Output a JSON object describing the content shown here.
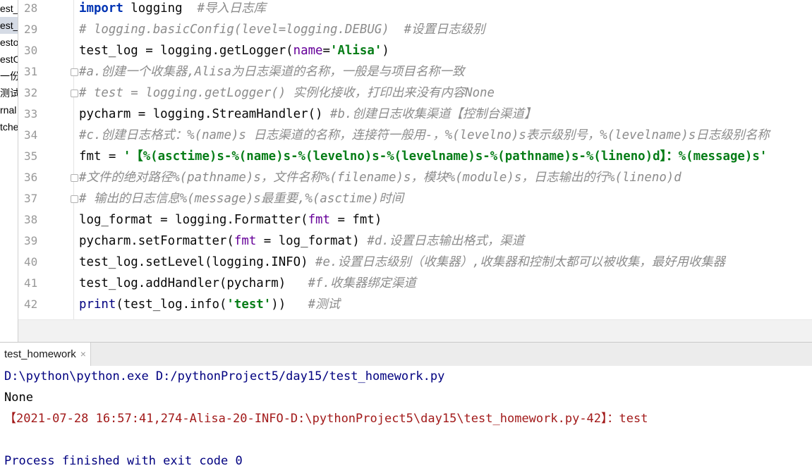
{
  "project_strip": {
    "items": [
      "est_",
      "est_",
      "esto",
      "estO",
      "一份流",
      "测试报",
      "rnal",
      "tche"
    ],
    "selected_index": 1
  },
  "editor": {
    "lines": [
      {
        "num": "28",
        "segments": [
          {
            "t": "import",
            "c": "kw"
          },
          {
            "t": " logging  ",
            "c": ""
          },
          {
            "t": "#导入日志库",
            "c": "cm"
          }
        ]
      },
      {
        "num": "29",
        "segments": [
          {
            "t": "# logging.basicConfig(level=logging.DEBUG)  #设置日志级别",
            "c": "cm"
          }
        ]
      },
      {
        "num": "30",
        "segments": [
          {
            "t": "test_log = logging.getLogger(",
            "c": ""
          },
          {
            "t": "name",
            "c": "param"
          },
          {
            "t": "=",
            "c": ""
          },
          {
            "t": "'Alisa'",
            "c": "str"
          },
          {
            "t": ")",
            "c": ""
          }
        ]
      },
      {
        "num": "31",
        "fold": true,
        "segments": [
          {
            "t": "#a.创建一个收集器,Alisa为日志渠道的名称，一般是与项目名称一致",
            "c": "cm"
          }
        ]
      },
      {
        "num": "32",
        "fold": true,
        "segments": [
          {
            "t": "# test = logging.getLogger() 实例化接收，打印出来没有内容None",
            "c": "cm"
          }
        ]
      },
      {
        "num": "33",
        "segments": [
          {
            "t": "pycharm = logging.StreamHandler() ",
            "c": ""
          },
          {
            "t": "#b.创建日志收集渠道【控制台渠道】",
            "c": "cm"
          }
        ]
      },
      {
        "num": "34",
        "segments": [
          {
            "t": "#c.创建日志格式：%(name)s 日志渠道的名称，连接符一般用-，%(levelno)s表示级别号，%(levelname)s日志级别名称",
            "c": "cm"
          }
        ]
      },
      {
        "num": "35",
        "segments": [
          {
            "t": "fmt = ",
            "c": ""
          },
          {
            "t": "'【%(asctime)s-%(name)s-%(levelno)s-%(levelname)s-%(pathname)s-%(lineno)d】：%(message)s'",
            "c": "str"
          }
        ]
      },
      {
        "num": "36",
        "fold": true,
        "segments": [
          {
            "t": "#文件的绝对路径%(pathname)s，文件名称%(filename)s，模块%(module)s，日志输出的行%(lineno)d",
            "c": "cm"
          }
        ]
      },
      {
        "num": "37",
        "fold": true,
        "segments": [
          {
            "t": "# 输出的日志信息%(message)s最重要,%(asctime)时间",
            "c": "cm"
          }
        ]
      },
      {
        "num": "38",
        "segments": [
          {
            "t": "log_format = logging.Formatter(",
            "c": ""
          },
          {
            "t": "fmt",
            "c": "param"
          },
          {
            "t": " = fmt)",
            "c": ""
          }
        ]
      },
      {
        "num": "39",
        "segments": [
          {
            "t": "pycharm.setFormatter(",
            "c": ""
          },
          {
            "t": "fmt",
            "c": "param"
          },
          {
            "t": " = log_format) ",
            "c": ""
          },
          {
            "t": "#d.设置日志输出格式，渠道",
            "c": "cm"
          }
        ]
      },
      {
        "num": "40",
        "segments": [
          {
            "t": "test_log.setLevel(logging.INFO) ",
            "c": ""
          },
          {
            "t": "#e.设置日志级别（收集器）,收集器和控制太都可以被收集，最好用收集器",
            "c": "cm"
          }
        ]
      },
      {
        "num": "41",
        "segments": [
          {
            "t": "test_log.addHandler(pycharm)   ",
            "c": ""
          },
          {
            "t": "#f.收集器绑定渠道",
            "c": "cm"
          }
        ]
      },
      {
        "num": "42",
        "segments": [
          {
            "t": "print",
            "c": "fn"
          },
          {
            "t": "(test_log.info(",
            "c": ""
          },
          {
            "t": "'test'",
            "c": "str"
          },
          {
            "t": "))   ",
            "c": ""
          },
          {
            "t": "#测试",
            "c": "cm"
          }
        ]
      }
    ]
  },
  "run_panel": {
    "tab_label": "test_homework",
    "tab_close": "×",
    "console": [
      {
        "text": "D:\\python\\python.exe D:/pythonProject5/day15/test_homework.py",
        "c": "con-cmd"
      },
      {
        "text": "None",
        "c": "con-out"
      },
      {
        "text": "【2021-07-28 16:57:41,274-Alisa-20-INFO-D:\\pythonProject5\\day15\\test_homework.py-42】：test",
        "c": "con-err"
      },
      {
        "text": "",
        "c": "con-out"
      },
      {
        "text": "Process finished with exit code 0",
        "c": "con-exit"
      }
    ]
  },
  "colors": {
    "keyword": "#0033b3",
    "comment": "#8c8c8c",
    "string": "#067d17",
    "param": "#660099",
    "console_error": "#a21a1a",
    "console_cmd": "#000080"
  }
}
